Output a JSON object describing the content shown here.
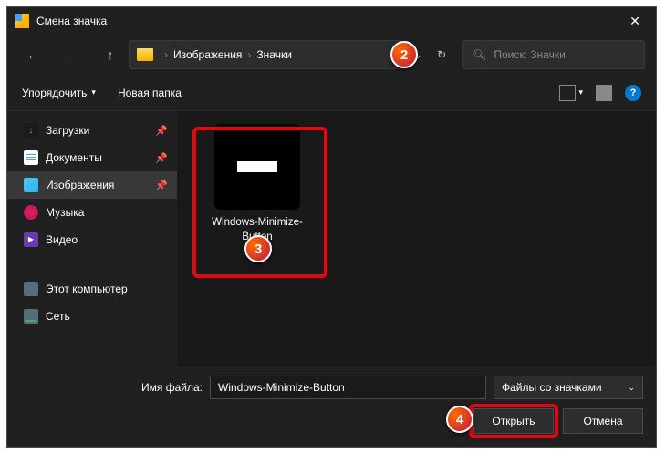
{
  "titlebar": {
    "title": "Смена значка"
  },
  "nav": {
    "crumb1": "Изображения",
    "crumb2": "Значки",
    "search_placeholder": "Поиск: Значки"
  },
  "toolbar": {
    "organize": "Упорядочить",
    "newfolder": "Новая папка"
  },
  "sidebar": {
    "downloads": "Загрузки",
    "documents": "Документы",
    "images": "Изображения",
    "music": "Музыка",
    "video": "Видео",
    "thispc": "Этот компьютер",
    "network": "Сеть"
  },
  "file": {
    "name": "Windows-Minimize-Button"
  },
  "footer": {
    "filename_label": "Имя файла:",
    "filename_value": "Windows-Minimize-Button",
    "filter": "Файлы со значками",
    "open": "Открыть",
    "cancel": "Отмена"
  },
  "markers": {
    "m2": "2",
    "m3": "3",
    "m4": "4"
  }
}
